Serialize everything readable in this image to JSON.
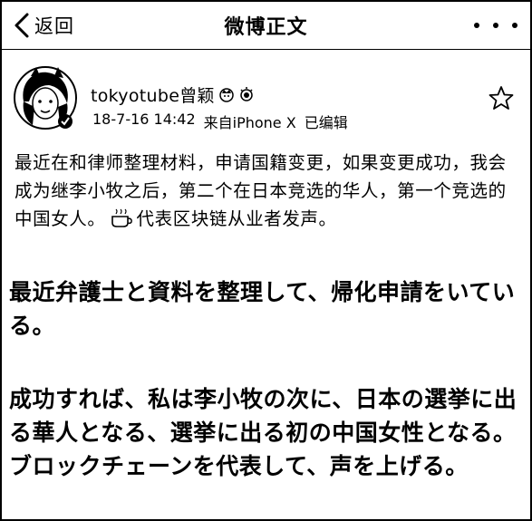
{
  "nav": {
    "back_label": "返回",
    "title": "微博正文"
  },
  "post": {
    "username": "tokyotube曾颖",
    "timestamp": "18-7-16 14:42",
    "source": "来自iPhone X",
    "edited": "已编辑",
    "body_cn_part1": "最近在和律师整理材料，申请国籍变更，如果变更成功，我会成为继李小牧之后，第二个在日本竞选的华人，第一个竞选的中国女人。",
    "body_cn_part2": "代表区块链从业者发声。"
  },
  "translation": {
    "para1": "最近弁護士と資料を整理して、帰化申請をいている。",
    "para2": "成功すれば、私は李小牧の次に、日本の選挙に出る華人となる、選挙に出る初の中国女性となる。ブロックチェーンを代表して、声を上げる。"
  },
  "icons": {
    "back": "chevron-left-icon",
    "more": "more-dots-icon",
    "favorite": "star-icon",
    "badge1": "crown-badge-icon",
    "badge2": "sun-badge-icon",
    "emoji": "coffee-cup-emoji"
  }
}
